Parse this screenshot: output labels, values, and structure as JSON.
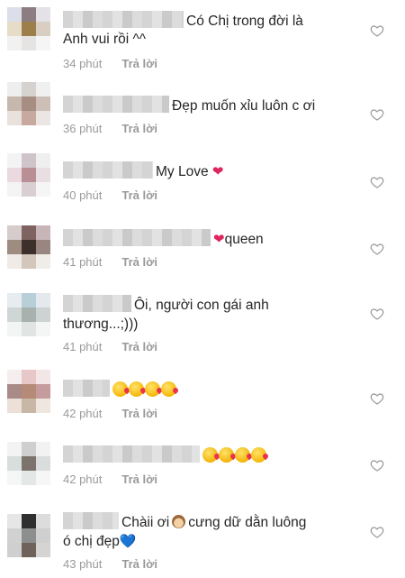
{
  "comments": [
    {
      "text_line1": "Có Chị trong đời là",
      "text_line2": "Anh vui rồi ^^",
      "time": "34 phút",
      "reply": "Trả lời"
    },
    {
      "text_line1": "Đẹp muốn xỉu luôn c ơi",
      "time": "36 phút",
      "reply": "Trả lời"
    },
    {
      "text_line1": "My Love",
      "emoji": "❤",
      "time": "40 phút",
      "reply": "Trả lời"
    },
    {
      "emoji": "❤",
      "text_line1": "queen",
      "time": "41 phút",
      "reply": "Trả lời"
    },
    {
      "text_line1": "Ôi, người con gái anh",
      "text_line2": "thương...;)))",
      "time": "41 phút",
      "reply": "Trả lời"
    },
    {
      "emoji_name": "face-blowing-kiss x4",
      "time": "42 phút",
      "reply": "Trả lời"
    },
    {
      "emoji_name": "kissing-face x3, face-blowing-kiss x1",
      "time": "42 phút",
      "reply": "Trả lời"
    },
    {
      "text_line1": "Chàii ơi",
      "text_line1b": "cưng dữ dằn luông",
      "text_line2": "ó chị đẹp",
      "emoji": "💙",
      "time": "43 phút",
      "reply": "Trả lời"
    }
  ],
  "icons": {
    "like": "heart-outline-icon",
    "monkey": "see-no-evil-monkey-icon"
  },
  "colors": {
    "meta": "#9a9a9a",
    "heart": "#e0245e",
    "blue_heart": "#3ba4ea"
  }
}
